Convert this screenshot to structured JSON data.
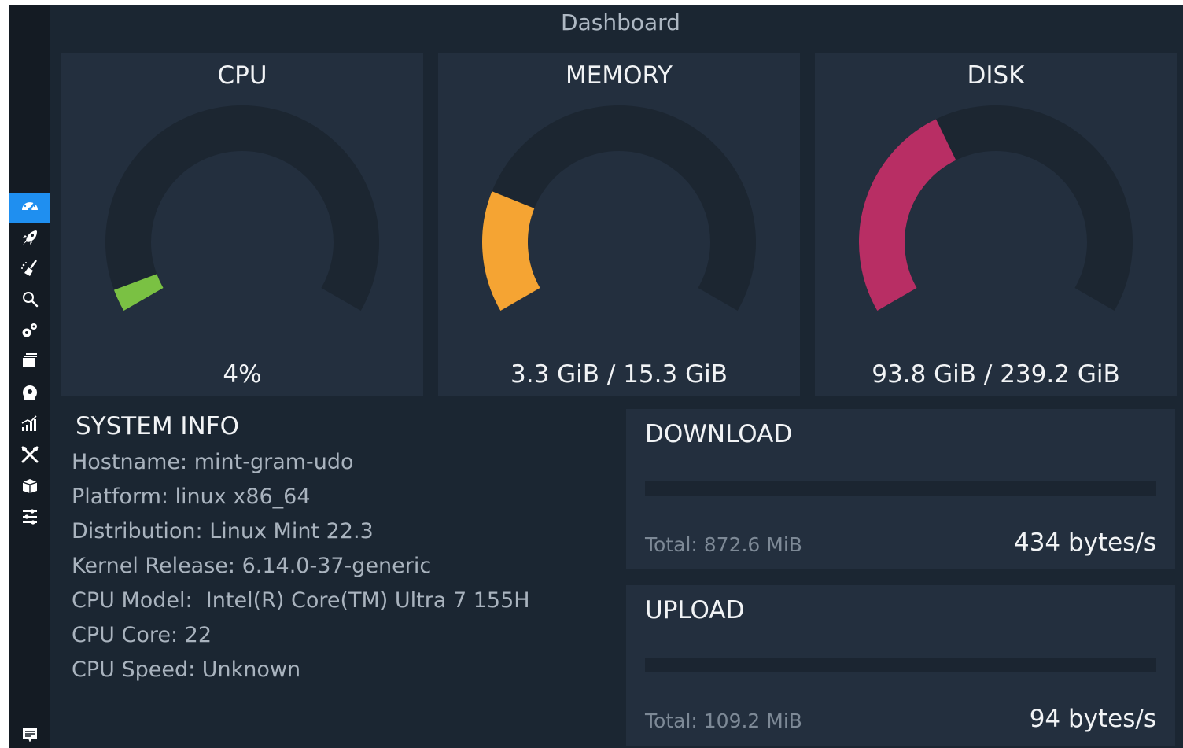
{
  "app": {
    "title": "Dashboard"
  },
  "sidebar": {
    "items": [
      {
        "icon": "speedometer-icon",
        "active": true
      },
      {
        "icon": "rocket-icon",
        "active": false
      },
      {
        "icon": "broom-icon",
        "active": false
      },
      {
        "icon": "search-icon",
        "active": false
      },
      {
        "icon": "gears-icon",
        "active": false
      },
      {
        "icon": "cards-icon",
        "active": false
      },
      {
        "icon": "disk-icon",
        "active": false
      },
      {
        "icon": "chart-icon",
        "active": false
      },
      {
        "icon": "tools-icon",
        "active": false
      },
      {
        "icon": "package-icon",
        "active": false
      },
      {
        "icon": "sliders-icon",
        "active": false
      }
    ],
    "footer_icon": "notes-icon",
    "accent": "#1f8ff0"
  },
  "gauges": {
    "cpu": {
      "title": "CPU",
      "value": "4%",
      "fraction": 0.04,
      "color": "#7ac143"
    },
    "memory": {
      "title": "MEMORY",
      "value": "3.3 GiB / 15.3 GiB",
      "fraction": 0.216,
      "color": "#f5a433"
    },
    "disk": {
      "title": "DISK",
      "value": "93.8 GiB / 239.2 GiB",
      "fraction": 0.392,
      "color": "#b82e64"
    }
  },
  "system_info": {
    "title": "SYSTEM INFO",
    "rows": [
      "Hostname: mint-gram-udo",
      "Platform: linux x86_64",
      "Distribution: Linux Mint 22.3",
      "Kernel Release: 6.14.0-37-generic",
      "CPU Model:  Intel(R) Core(TM) Ultra 7 155H",
      "CPU Core: 22",
      "CPU Speed: Unknown"
    ]
  },
  "network": {
    "download": {
      "title": "DOWNLOAD",
      "total": "Total: 872.6 MiB",
      "rate": "434 bytes/s",
      "fraction": 0
    },
    "upload": {
      "title": "UPLOAD",
      "total": "Total: 109.2 MiB",
      "rate": "94 bytes/s",
      "fraction": 0
    }
  }
}
